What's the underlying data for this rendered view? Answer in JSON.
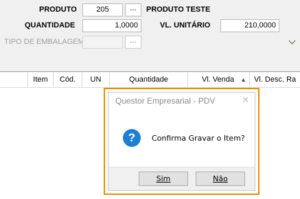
{
  "form": {
    "produto": {
      "label": "PRODUTO",
      "code": "205",
      "lookup_label": "...",
      "description": "PRODUTO TESTE"
    },
    "quantidade": {
      "label": "QUANTIDADE",
      "value": "1,0000"
    },
    "vl_unitario": {
      "label": "VL. UNITÁRIO",
      "value": "210,0000"
    },
    "tipo_embalagem": {
      "label": "TIPO DE EMBALAGEM",
      "value": "",
      "lookup_label": "..."
    }
  },
  "grid": {
    "columns": [
      "Item",
      "Cód.",
      "UN",
      "Quantidade",
      "Vl. Venda",
      "Vl. Desc. Ra"
    ],
    "sorted_column": "Vl. Venda",
    "sort_direction": "ascending"
  },
  "dialog": {
    "title": "Questor Empresarial - PDV",
    "close_label": "✕",
    "icon": "question-icon",
    "icon_glyph": "?",
    "message": "Confirma Gravar o Item?",
    "yes_label": "Sim",
    "no_label": "Não"
  },
  "colors": {
    "highlight": "#f08a00",
    "icon": "#1e7fd3"
  }
}
